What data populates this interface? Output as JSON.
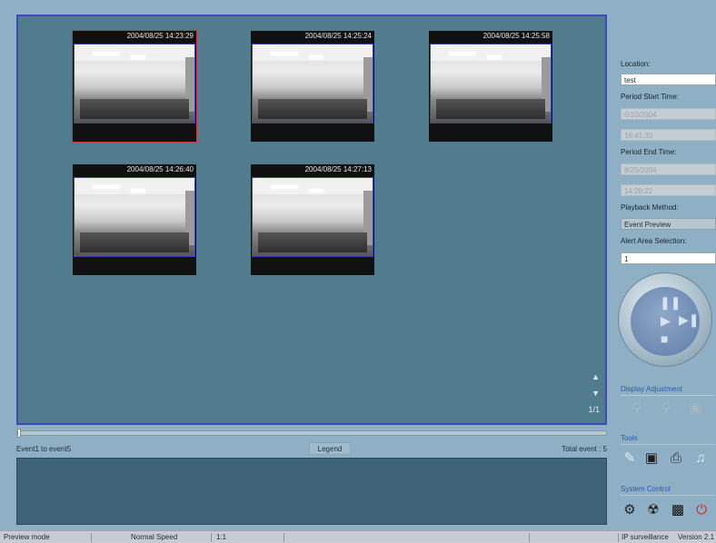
{
  "thumbnails": [
    {
      "timestamp": "2004/08/25 14:23:29",
      "selected": true
    },
    {
      "timestamp": "2004/08/25 14:25:24",
      "selected": false
    },
    {
      "timestamp": "2004/08/25 14:25:58",
      "selected": false
    },
    {
      "timestamp": "2004/08/25 14:26:40",
      "selected": false
    },
    {
      "timestamp": "2004/08/25 14:27:13",
      "selected": false
    }
  ],
  "preview": {
    "page_indicator": "1/1",
    "side_icons": [
      "page-up-icon",
      "page-down-icon"
    ]
  },
  "event_bar": {
    "range_text": "Event1 to event5",
    "legend_label": "Legend",
    "total_text": "Total event : 5",
    "seek_fraction": 0.0
  },
  "panel": {
    "location_label": "Location:",
    "location_value": "test",
    "start_label": "Period Start Time:",
    "start_date": "6/10/2004",
    "start_time": "16:41:30",
    "end_label": "Period End Time:",
    "end_date": "8/25/2004",
    "end_time": "14:28:22",
    "playback_label": "Playback Method:",
    "playback_value": "Event Preview",
    "alert_label": "Alert Area Selection:",
    "alert_value": "1"
  },
  "controls": {
    "icons": [
      "bell-icon",
      "pause-icon",
      "play-icon",
      "next-frame-icon",
      "stop-icon"
    ]
  },
  "display_adjustment": {
    "title": "Display Adjustment",
    "icons": [
      "zoom-in-icon",
      "zoom-out-icon",
      "fit-screen-icon"
    ]
  },
  "tools": {
    "title": "Tools",
    "icons": [
      "pen-icon",
      "camera-icon",
      "print-icon",
      "audio-icon"
    ]
  },
  "system_control": {
    "title": "System Control",
    "icons": [
      "settings-icon",
      "network-icon",
      "monitor-icon",
      "power-icon"
    ]
  },
  "status": {
    "mode": "Preview mode",
    "speed": "Normal Speed",
    "ratio": "1:1",
    "product": "IP surveillance",
    "version": "Version 2.1"
  },
  "colors": {
    "accent_blue": "#3f4cb8",
    "preview_bg": "#517c8e",
    "selected_border": "#c0393f",
    "power_red": "#d12b2b"
  }
}
